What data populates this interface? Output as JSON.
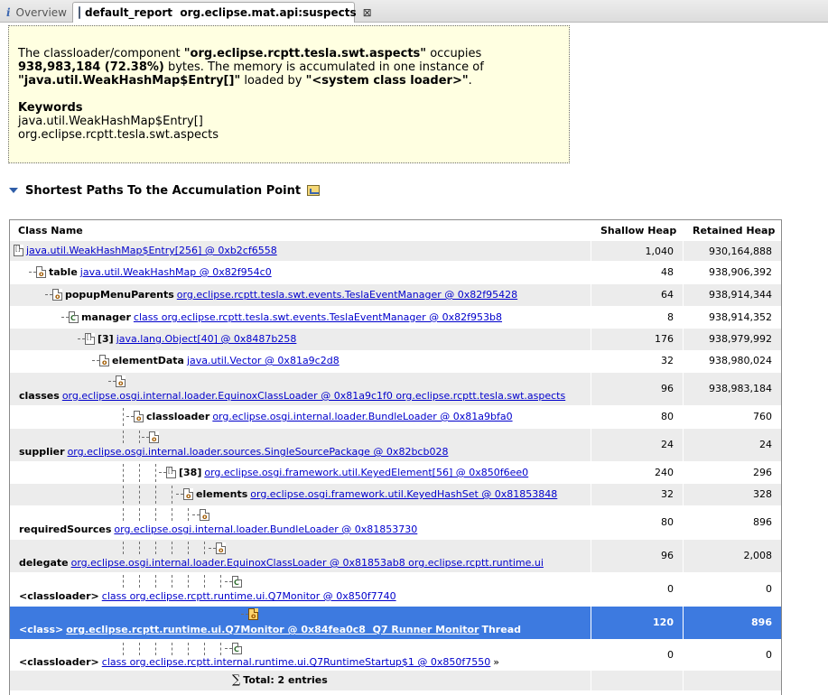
{
  "tabs": [
    {
      "label": "Overview",
      "icon": "info-icon"
    },
    {
      "label": "default_report  org.eclipse.mat.api:suspects",
      "icon": "database-icon"
    }
  ],
  "summary": {
    "s1": "The classloader/component ",
    "component": "\"org.eclipse.rcptt.tesla.swt.aspects\"",
    "s2": " occupies",
    "bytes": "938,983,184 (72.38%)",
    "s3": " bytes. The memory is accumulated in one instance of",
    "instance": "\"java.util.WeakHashMap$Entry[]\"",
    "s4": " loaded by ",
    "loader": "\"<system class loader>\"",
    "s5": ".",
    "keywords_title": "Keywords",
    "keywords": [
      "java.util.WeakHashMap$Entry[]",
      "org.eclipse.rcptt.tesla.swt.aspects"
    ]
  },
  "section": {
    "title": "Shortest Paths To the Accumulation Point"
  },
  "table": {
    "headers": {
      "name": "Class Name",
      "shallow": "Shallow Heap",
      "retained": "Retained Heap"
    },
    "rows": [
      {
        "prefix": "",
        "link": "java.util.WeakHashMap$Entry[256] @ 0xb2cf6558",
        "suffix": "",
        "shallow": "1,040",
        "retained": "930,164,888"
      },
      {
        "prefix": "table",
        "link": "java.util.WeakHashMap @ 0x82f954c0",
        "suffix": "",
        "shallow": "48",
        "retained": "938,906,392"
      },
      {
        "prefix": "popupMenuParents",
        "link": "org.eclipse.rcptt.tesla.swt.events.TeslaEventManager @ 0x82f95428",
        "suffix": "",
        "shallow": "64",
        "retained": "938,914,344"
      },
      {
        "prefix": "manager",
        "link": "class org.eclipse.rcptt.tesla.swt.events.TeslaEventManager @ 0x82f953b8",
        "suffix": "",
        "shallow": "8",
        "retained": "938,914,352"
      },
      {
        "prefix": "[3]",
        "link": "java.lang.Object[40] @ 0x8487b258",
        "suffix": "",
        "shallow": "176",
        "retained": "938,979,992"
      },
      {
        "prefix": "elementData",
        "link": "java.util.Vector @ 0x81a9c2d8",
        "suffix": "",
        "shallow": "32",
        "retained": "938,980,024"
      },
      {
        "prefix": "classes",
        "link": "org.eclipse.osgi.internal.loader.EquinoxClassLoader @ 0x81a9c1f0 org.eclipse.rcptt.tesla.swt.aspects",
        "suffix": "",
        "shallow": "96",
        "retained": "938,983,184"
      },
      {
        "prefix": "classloader",
        "link": "org.eclipse.osgi.internal.loader.BundleLoader @ 0x81a9bfa0",
        "suffix": "",
        "shallow": "80",
        "retained": "760"
      },
      {
        "prefix": "supplier",
        "link": "org.eclipse.osgi.internal.loader.sources.SingleSourcePackage @ 0x82bcb028",
        "suffix": "",
        "shallow": "24",
        "retained": "24"
      },
      {
        "prefix": "[38]",
        "link": "org.eclipse.osgi.framework.util.KeyedElement[56] @ 0x850f6ee0",
        "suffix": "",
        "shallow": "240",
        "retained": "296"
      },
      {
        "prefix": "elements",
        "link": "org.eclipse.osgi.framework.util.KeyedHashSet @ 0x81853848",
        "suffix": "",
        "shallow": "32",
        "retained": "328"
      },
      {
        "prefix": "requiredSources",
        "link": "org.eclipse.osgi.internal.loader.BundleLoader @ 0x81853730",
        "suffix": "",
        "shallow": "80",
        "retained": "896"
      },
      {
        "prefix": "delegate",
        "link": "org.eclipse.osgi.internal.loader.EquinoxClassLoader @ 0x81853ab8 org.eclipse.rcptt.runtime.ui",
        "suffix": "",
        "shallow": "96",
        "retained": "2,008"
      },
      {
        "prefix": "<classloader>",
        "link": "class org.eclipse.rcptt.runtime.ui.Q7Monitor @ 0x850f7740",
        "suffix": "",
        "shallow": "0",
        "retained": "0"
      },
      {
        "prefix": "<class>",
        "link": "org.eclipse.rcptt.runtime.ui.Q7Monitor @ 0x84fea0c8  Q7 Runner Monitor",
        "suffix": " Thread",
        "shallow": "120",
        "retained": "896"
      },
      {
        "prefix": "<classloader>",
        "link": "class org.eclipse.rcptt.internal.runtime.ui.Q7RuntimeStartup$1 @ 0x850f7550",
        "suffix": " »",
        "shallow": "0",
        "retained": "0"
      }
    ],
    "total": {
      "symbol": "∑",
      "label": "Total: 2 entries"
    }
  },
  "colors": {
    "selection": "#3d7ae0",
    "summary_bg": "#ffffe1",
    "link": "#0000cc"
  }
}
